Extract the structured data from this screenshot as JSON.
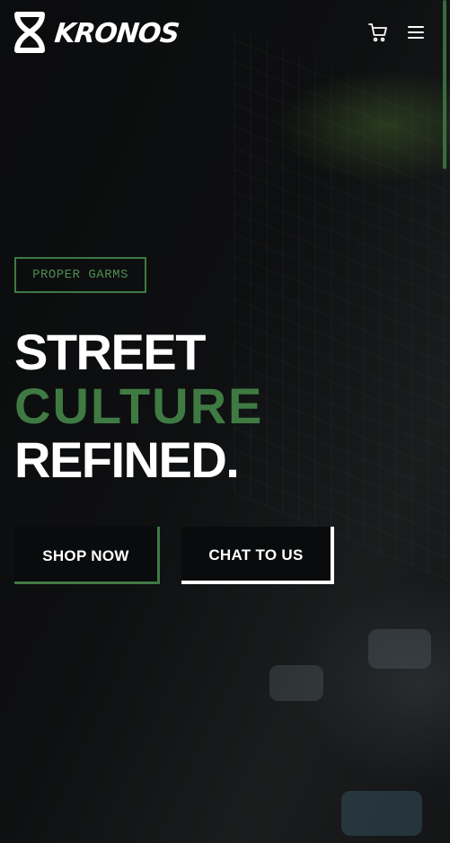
{
  "brand": {
    "name": "KRONOS",
    "accent_color": "#3f7a43",
    "background_color": "#0b0c0d"
  },
  "header": {
    "icons": [
      "cart-icon",
      "menu-icon"
    ]
  },
  "hero": {
    "tag_label": "PROPER GARMS",
    "headline": {
      "line_1": "STREET",
      "line_2": "CULTURE",
      "line_3": "REFINED."
    },
    "buttons": {
      "shop_label": "SHOP NOW",
      "chat_label": "CHAT TO US"
    }
  }
}
